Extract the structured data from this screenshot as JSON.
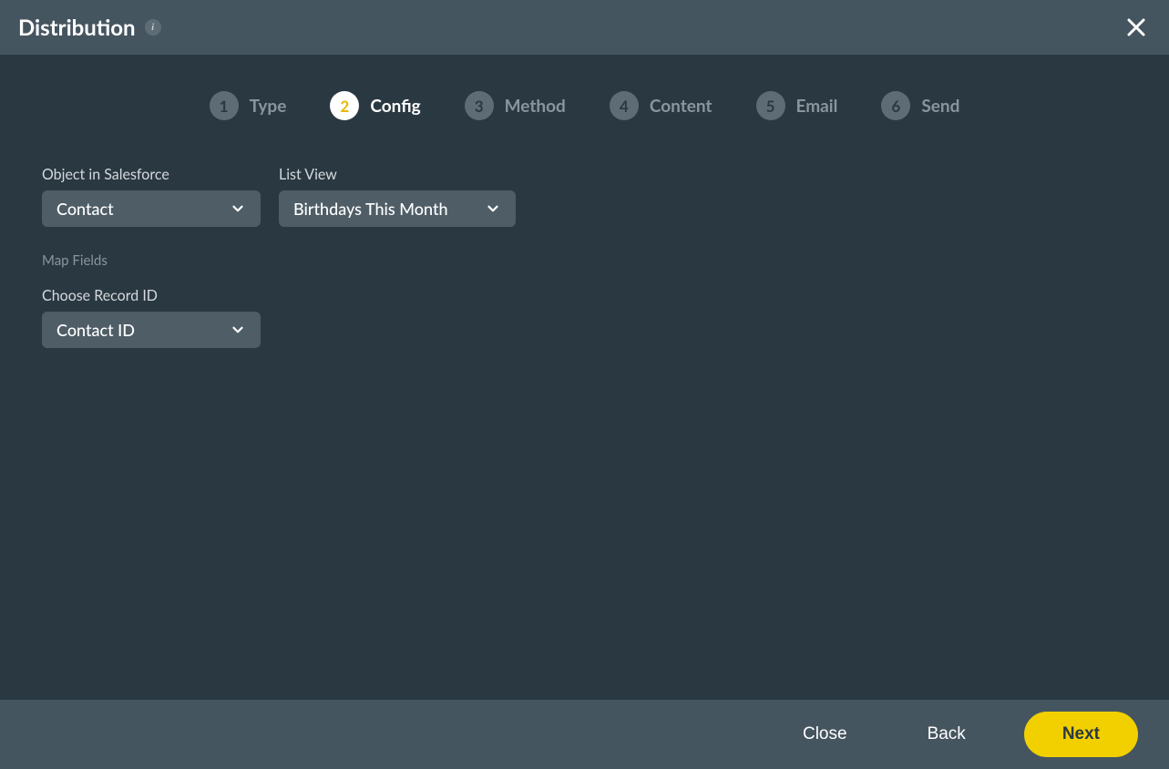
{
  "header": {
    "title": "Distribution"
  },
  "stepper": {
    "steps": [
      {
        "num": "1",
        "label": "Type",
        "active": false
      },
      {
        "num": "2",
        "label": "Config",
        "active": true
      },
      {
        "num": "3",
        "label": "Method",
        "active": false
      },
      {
        "num": "4",
        "label": "Content",
        "active": false
      },
      {
        "num": "5",
        "label": "Email",
        "active": false
      },
      {
        "num": "6",
        "label": "Send",
        "active": false
      }
    ]
  },
  "form": {
    "object_label": "Object in Salesforce",
    "object_value": "Contact",
    "listview_label": "List View",
    "listview_value": "Birthdays This Month",
    "map_fields_label": "Map Fields",
    "record_id_label": "Choose Record ID",
    "record_id_value": "Contact ID"
  },
  "footer": {
    "close": "Close",
    "back": "Back",
    "next": "Next"
  }
}
